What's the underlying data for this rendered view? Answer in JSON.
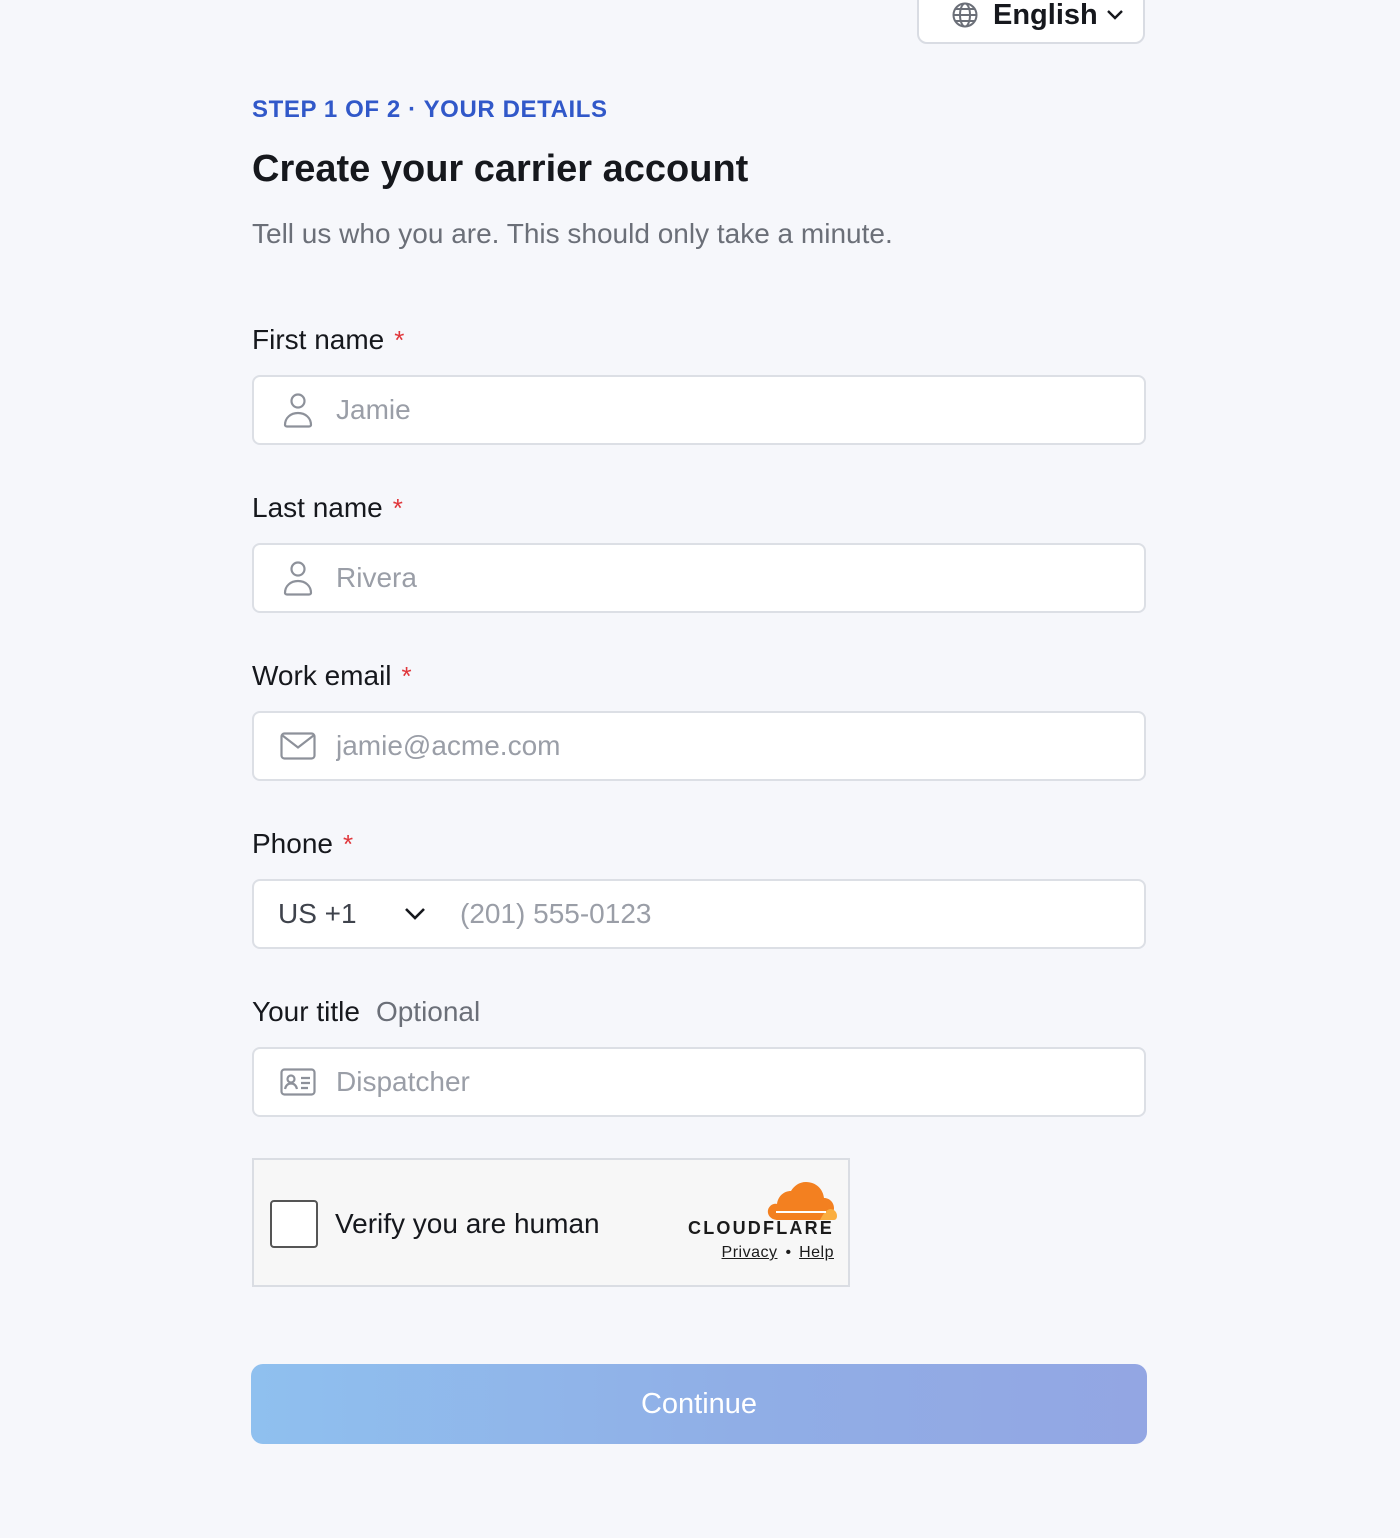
{
  "language": {
    "selected": "English"
  },
  "header": {
    "step": "STEP 1 OF 2 · YOUR DETAILS",
    "title": "Create your carrier account",
    "subtitle": "Tell us who you are. This should only take a minute."
  },
  "form": {
    "first_name": {
      "label": "First name",
      "required_mark": "*",
      "placeholder": "Jamie",
      "value": "",
      "icon": "user-icon"
    },
    "last_name": {
      "label": "Last name",
      "required_mark": "*",
      "placeholder": "Rivera",
      "value": "",
      "icon": "user-icon"
    },
    "email": {
      "label": "Work email",
      "required_mark": "*",
      "placeholder": "jamie@acme.com",
      "value": "",
      "icon": "mail-icon"
    },
    "phone": {
      "label": "Phone",
      "required_mark": "*",
      "country": "US +1",
      "placeholder": "(201) 555-0123",
      "value": ""
    },
    "title": {
      "label": "Your title",
      "optional": "Optional",
      "placeholder": "Dispatcher",
      "value": "",
      "icon": "id-card-icon"
    }
  },
  "captcha": {
    "label": "Verify you are human",
    "brand": "CLOUDFLARE",
    "privacy": "Privacy",
    "separator": "•",
    "help": "Help",
    "checked": false
  },
  "actions": {
    "continue_label": "Continue"
  },
  "colors": {
    "accent": "#3158c9",
    "required": "#e0363b",
    "cloudflare_orange": "#f38020"
  }
}
